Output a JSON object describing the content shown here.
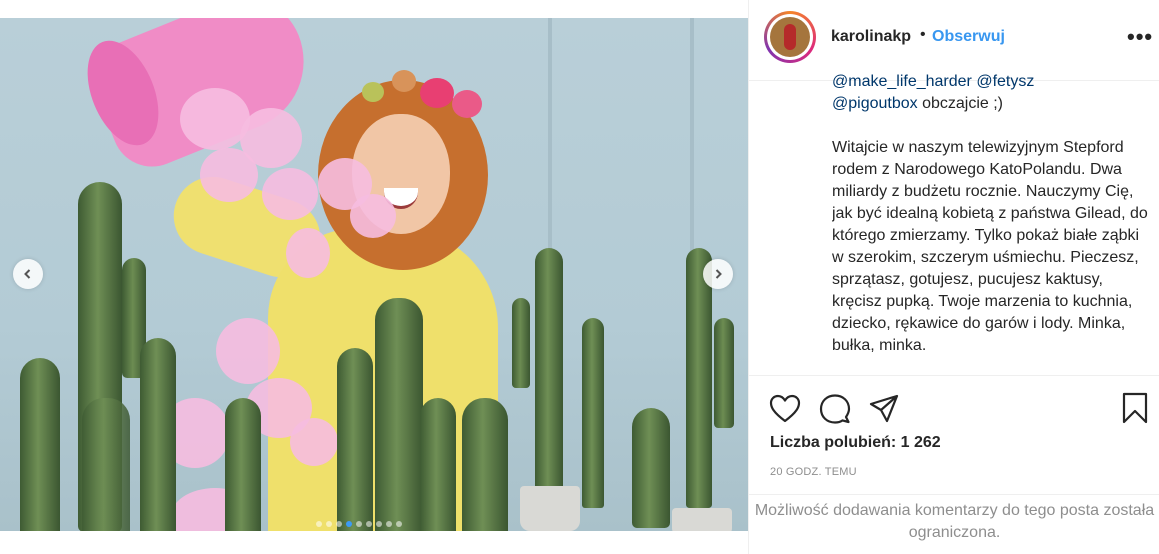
{
  "post": {
    "username": "karolinakp",
    "separator": "•",
    "follow_label": "Obserwuj",
    "more_label": "•••",
    "caption": {
      "line1_mentions": [
        "@make_life_harder",
        "@fetysz"
      ],
      "line2_mention": "@pigoutbox",
      "line2_rest": " obczajcie ;)",
      "paragraph": "Witajcie w naszym telewizyjnym Stepford rodem z Narodowego KatoPolandu. Dwa miliardy z budżetu rocznie. Nauczymy Cię, jak być idealną kobietą z państwa Gilead, do którego zmierzamy. Tylko pokaż białe ząbki w szerokim, szczerym uśmiechu. Pieczesz, sprzątasz, gotujesz, pucujesz kaktusy, kręcisz pupką. Twoje marzenia to kuchnia, dziecko, rękawice do garów i lody. Minka, bułka, minka."
    },
    "likes_text": "Liczba polubień: 1 262",
    "time_text": "20 GODZ. TEMU",
    "comments_disabled": "Możliwość dodawania komentarzy do tego posta została ograniczona."
  },
  "media": {
    "carousel_dots": 9,
    "active_dot": 3
  },
  "icons": {
    "like": "heart-icon",
    "comment": "comment-icon",
    "share": "paper-plane-icon",
    "save": "bookmark-icon",
    "prev": "chevron-left-icon",
    "next": "chevron-right-icon",
    "more": "more-options-icon"
  },
  "colors": {
    "follow_blue": "#3897f0",
    "mention": "#00376b",
    "muted": "#8e8e8e",
    "active_dot": "#3b9af7"
  }
}
